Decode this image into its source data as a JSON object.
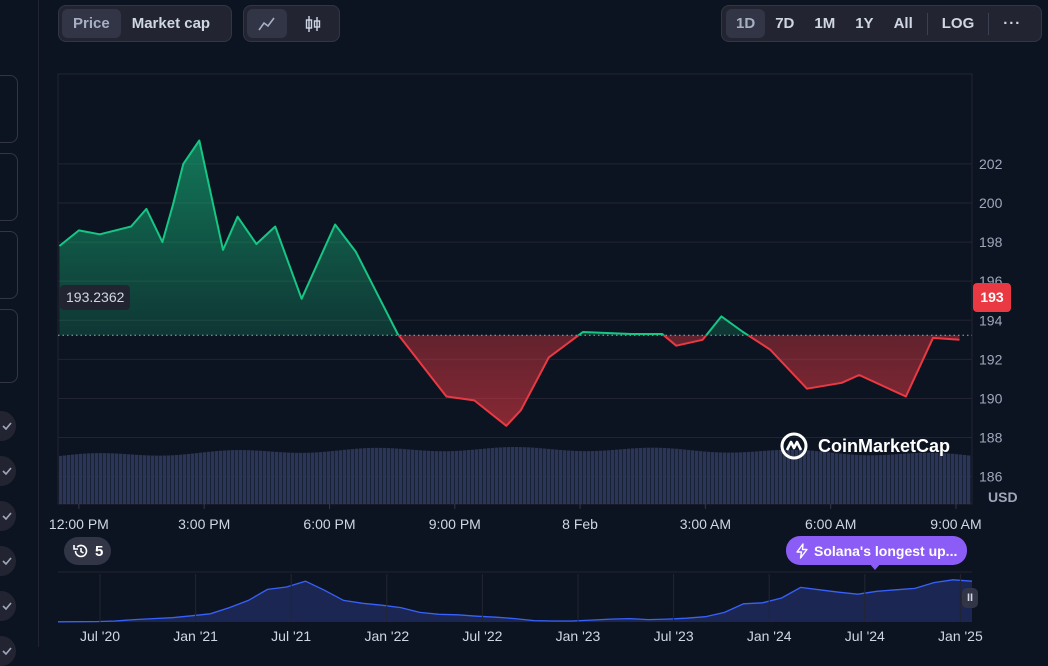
{
  "chart_toggle": {
    "price": "Price",
    "market_cap": "Market cap"
  },
  "chart_style": {
    "line_icon": "line-chart-icon",
    "candle_icon": "candlestick-icon"
  },
  "range_tabs": [
    "1D",
    "7D",
    "1M",
    "1Y",
    "All"
  ],
  "range_active": "1D",
  "log_label": "LOG",
  "more_icon": "ellipsis-icon",
  "watermark": "CoinMarketCap",
  "history_count": "5",
  "promo_text": "Solana's longest up...",
  "colors": {
    "up": "#16c784",
    "down": "#ea3943",
    "bg": "#0d1421",
    "volume": "#2b3557",
    "overview": "#3861fb",
    "promo": "#8b5cf6"
  },
  "chart_data": {
    "type": "area",
    "title": "",
    "xlabel": "",
    "ylabel": "USD",
    "reference_value": 193.2362,
    "reference_label": "193.2362",
    "current_value": 193,
    "current_label": "193",
    "ylim": [
      184.6,
      206.6
    ],
    "y_ticks": [
      202,
      200,
      198,
      196,
      194,
      192,
      190,
      188,
      186
    ],
    "x_tick_labels": [
      "12:00 PM",
      "3:00 PM",
      "6:00 PM",
      "9:00 PM",
      "8 Feb",
      "3:00 AM",
      "6:00 AM",
      "9:00 AM"
    ],
    "x_hours": [
      0,
      30,
      48,
      63,
      85,
      101,
      137,
      165,
      195,
      240,
      262,
      285,
      300,
      315,
      338,
      372,
      393,
      420,
      447,
      485,
      533,
      563,
      623,
      693,
      733,
      779,
      800,
      840,
      889,
      958,
      1003,
      1023,
      1061,
      1088,
      1119,
      1158,
      1211,
      1261,
      1286,
      1353,
      1392,
      1430
    ],
    "y_values": [
      193.3,
      195.0,
      195.4,
      196.5,
      197.4,
      197.0,
      197.8,
      198.6,
      198.4,
      198.8,
      199.7,
      198.0,
      199.9,
      202.0,
      203.2,
      197.6,
      199.3,
      197.9,
      198.8,
      195.1,
      198.9,
      197.5,
      193.3,
      190.1,
      189.9,
      188.6,
      189.4,
      192.1,
      193.4,
      193.3,
      193.3,
      192.7,
      193.0,
      194.2,
      193.4,
      192.5,
      190.5,
      190.8,
      191.2,
      190.1,
      193.1,
      193.0
    ],
    "volume_label": "Volume",
    "overview": {
      "type": "area",
      "x_tick_labels": [
        "Jul '20",
        "Jan '21",
        "Jul '21",
        "Jan '22",
        "Jul '22",
        "Jan '23",
        "Jul '23",
        "Jan '24",
        "Jul '24",
        "Jan '25"
      ],
      "values": [
        0.005,
        0.007,
        0.008,
        0.02,
        0.05,
        0.07,
        0.09,
        0.13,
        0.17,
        0.3,
        0.45,
        0.68,
        0.73,
        0.85,
        0.66,
        0.45,
        0.39,
        0.35,
        0.3,
        0.2,
        0.16,
        0.15,
        0.12,
        0.1,
        0.07,
        0.03,
        0.02,
        0.02,
        0.04,
        0.06,
        0.07,
        0.05,
        0.06,
        0.08,
        0.11,
        0.2,
        0.38,
        0.4,
        0.5,
        0.72,
        0.67,
        0.62,
        0.58,
        0.64,
        0.67,
        0.7,
        0.82,
        0.88,
        0.85
      ]
    }
  }
}
